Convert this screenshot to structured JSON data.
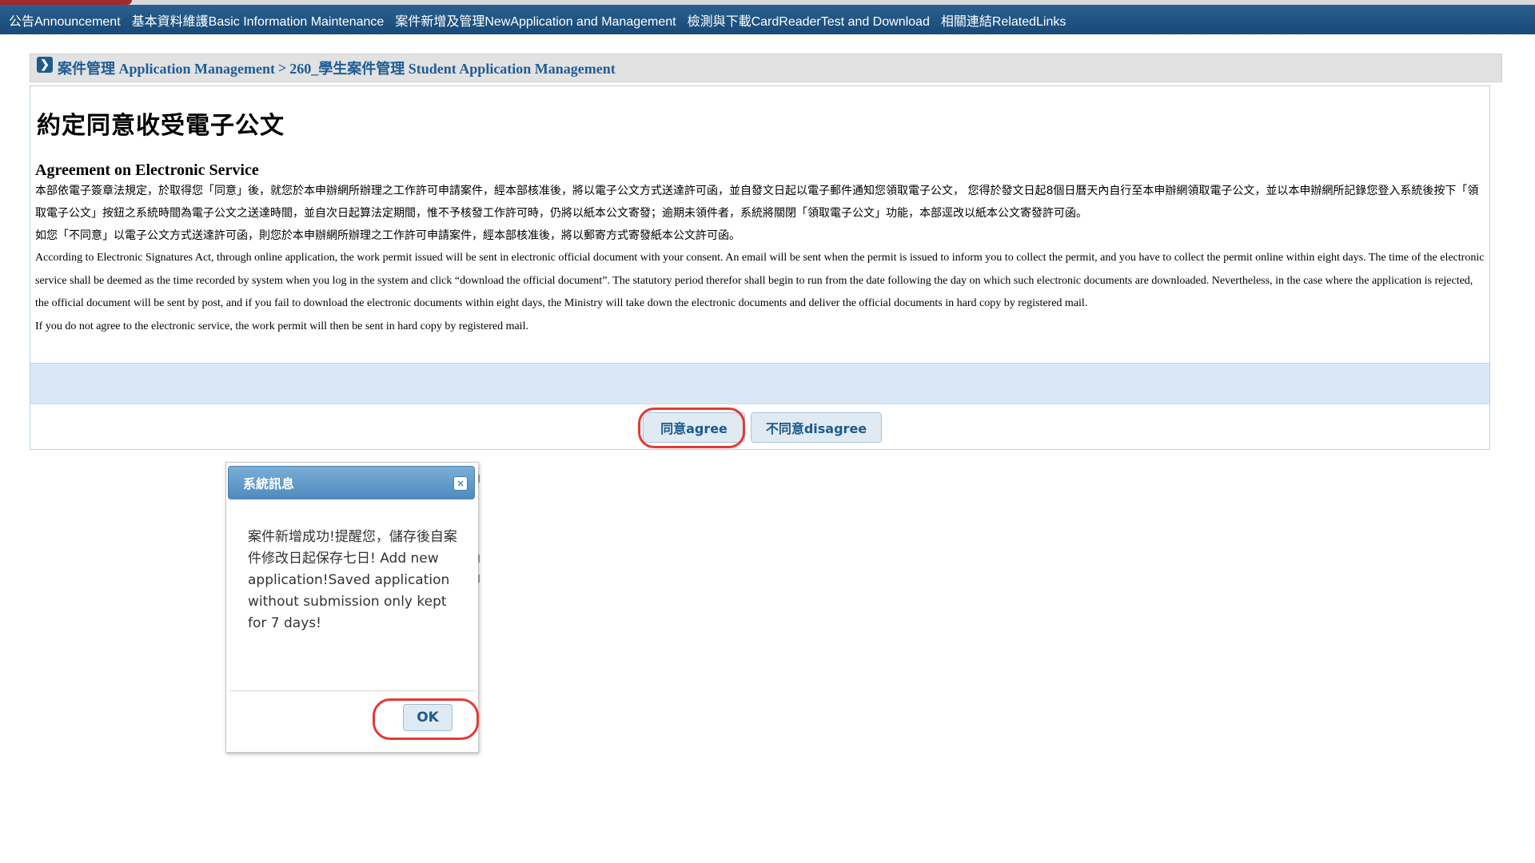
{
  "nav": {
    "items": [
      "公告Announcement",
      "基本資料維護Basic Information Maintenance",
      "案件新增及管理NewApplication and Management",
      "檢測與下載CardReaderTest and Download",
      "相關連結RelatedLinks"
    ]
  },
  "breadcrumb": {
    "part1": "案件管理 Application Management",
    "separator": ">",
    "part2": "260_學生案件管理 Student Application Management"
  },
  "content": {
    "title": "約定同意收受電子公文",
    "heading": "Agreement on Electronic Service",
    "zh_para1": "本部依電子簽章法規定，於取得您「同意」後，就您於本申辦網所辦理之工作許可申請案件，經本部核准後，將以電子公文方式送達許可函，並自發文日起以電子郵件通知您領取電子公文， 您得於發文日起8個日曆天內自行至本申辦網領取電子公文，並以本申辦網所記錄您登入系統後按下「領取電子公文」按鈕之系統時間為電子公文之送達時間，並自次日起算法定期間，惟不予核發工作許可時，仍將以紙本公文寄發；逾期未領件者，系統將關閉「領取電子公文」功能，本部逕改以紙本公文寄發許可函。",
    "zh_para2": "如您「不同意」以電子公文方式送達許可函，則您於本申辦網所辦理之工作許可申請案件，經本部核准後，將以郵寄方式寄發紙本公文許可函。",
    "en_para1": "According to Electronic Signatures Act, through online application, the work permit issued will be sent in electronic official document with your consent. An email will be sent when the permit is issued to inform you to collect the permit, and you have to collect the permit online within eight days. The time of the electronic service shall be deemed as the time recorded by system when you log in the system and click “download the official document”. The statutory period therefor shall begin to run from the date following the day on which such electronic documents are downloaded. Nevertheless, in the case where the application is rejected, the official document will be sent by post, and if you fail to download the electronic documents within eight days, the Ministry will take down the electronic documents and deliver the official documents in hard copy by registered mail.",
    "en_para2": "If you do not agree to the electronic service, the work permit will then be sent in hard copy by registered mail."
  },
  "buttons": {
    "agree": "同意agree",
    "disagree": "不同意disagree"
  },
  "dialog": {
    "title": "系統訊息",
    "close": "×",
    "message": "案件新增成功!提醒您，儲存後自案件修改日起保存七日! Add new application!Saved application without submission only kept for 7 days!",
    "ok": "OK"
  },
  "colors": {
    "nav_bg": "#1c4f7d",
    "link_blue": "#1f5c95",
    "highlight": "#e53935",
    "dialog_title_bg": "#5b93c6"
  }
}
